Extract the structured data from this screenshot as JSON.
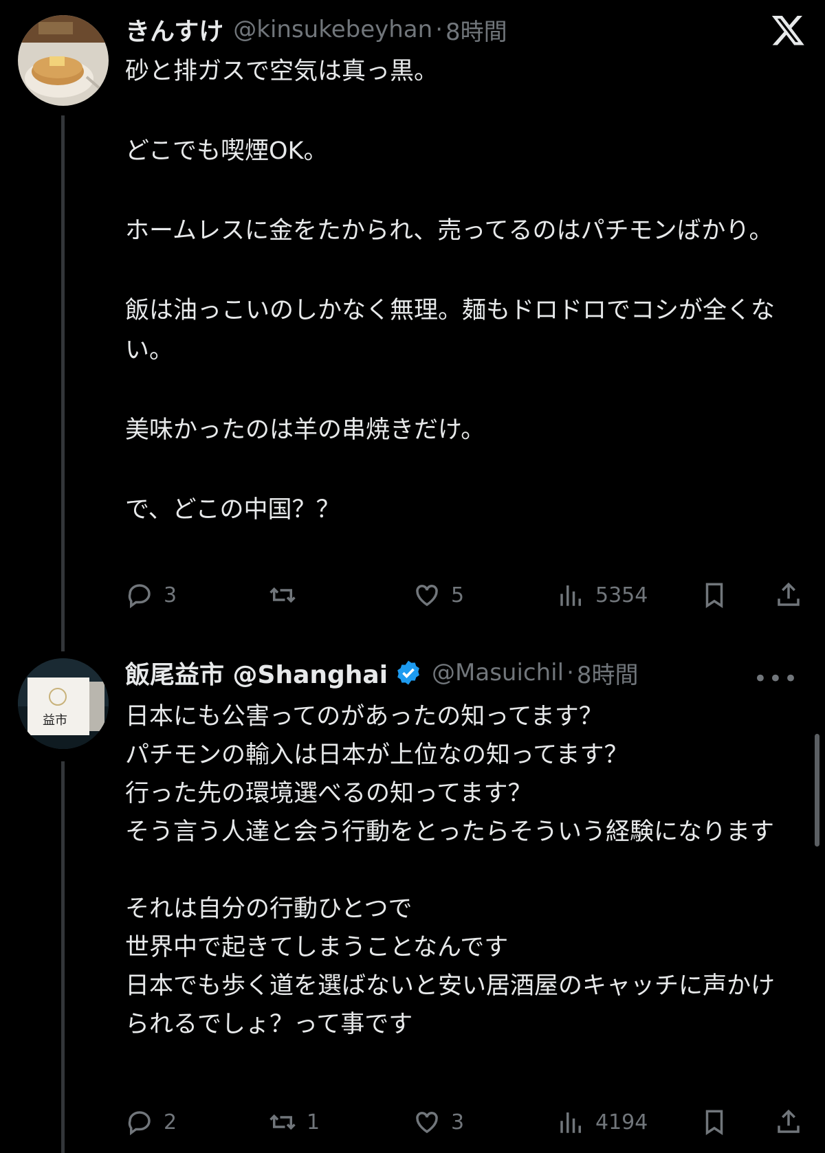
{
  "tweets": [
    {
      "name": "きんすけ",
      "handle": "@kinsukebeyhan",
      "separator": "·",
      "time": "8時間",
      "avatar_icon": "pancake-avatar",
      "paragraphs": [
        "砂と排ガスで空気は真っ黒。",
        "どこでも喫煙OK。",
        "ホームレスに金をたかられ、売ってるのはパチモンばかり。",
        "飯は油っこいのしかなく無理。麺もドロドロでコシが全くない。",
        "美味かったのは羊の串焼きだけ。",
        "で、どこの中国？？"
      ],
      "replies": "3",
      "retweets": "",
      "likes": "5",
      "views": "5354"
    },
    {
      "name": "飯尾益市 @Shanghai",
      "handle": "@Masuichil",
      "separator": "·",
      "time": "8時間",
      "avatar_icon": "masuichi-sign-avatar",
      "avatar_text": "益市",
      "verified": true,
      "paragraphs": [
        "日本にも公害ってのがあったの知ってます？\nパチモンの輸入は日本が上位なの知ってます？\n行った先の環境選べるの知ってます？\nそう言う人達と会う行動をとったらそういう経験になります",
        "それは自分の行動ひとつで\n世界中で起きてしまうことなんです\n日本でも歩く道を選ばないと安い居酒屋のキャッチに声かけられるでしょ？って事です"
      ],
      "replies": "2",
      "retweets": "1",
      "likes": "3",
      "views": "4194"
    }
  ],
  "icons": {
    "reply": "reply-icon",
    "retweet": "retweet-icon",
    "like": "like-icon",
    "views": "views-icon",
    "bookmark": "bookmark-icon",
    "share": "share-icon",
    "brand": "x-logo-icon",
    "more": "more-icon"
  },
  "colors": {
    "background": "#000000",
    "text": "#e7e9ea",
    "muted": "#71767b",
    "verified": "#1d9bf0"
  },
  "more_glyph": "•••"
}
